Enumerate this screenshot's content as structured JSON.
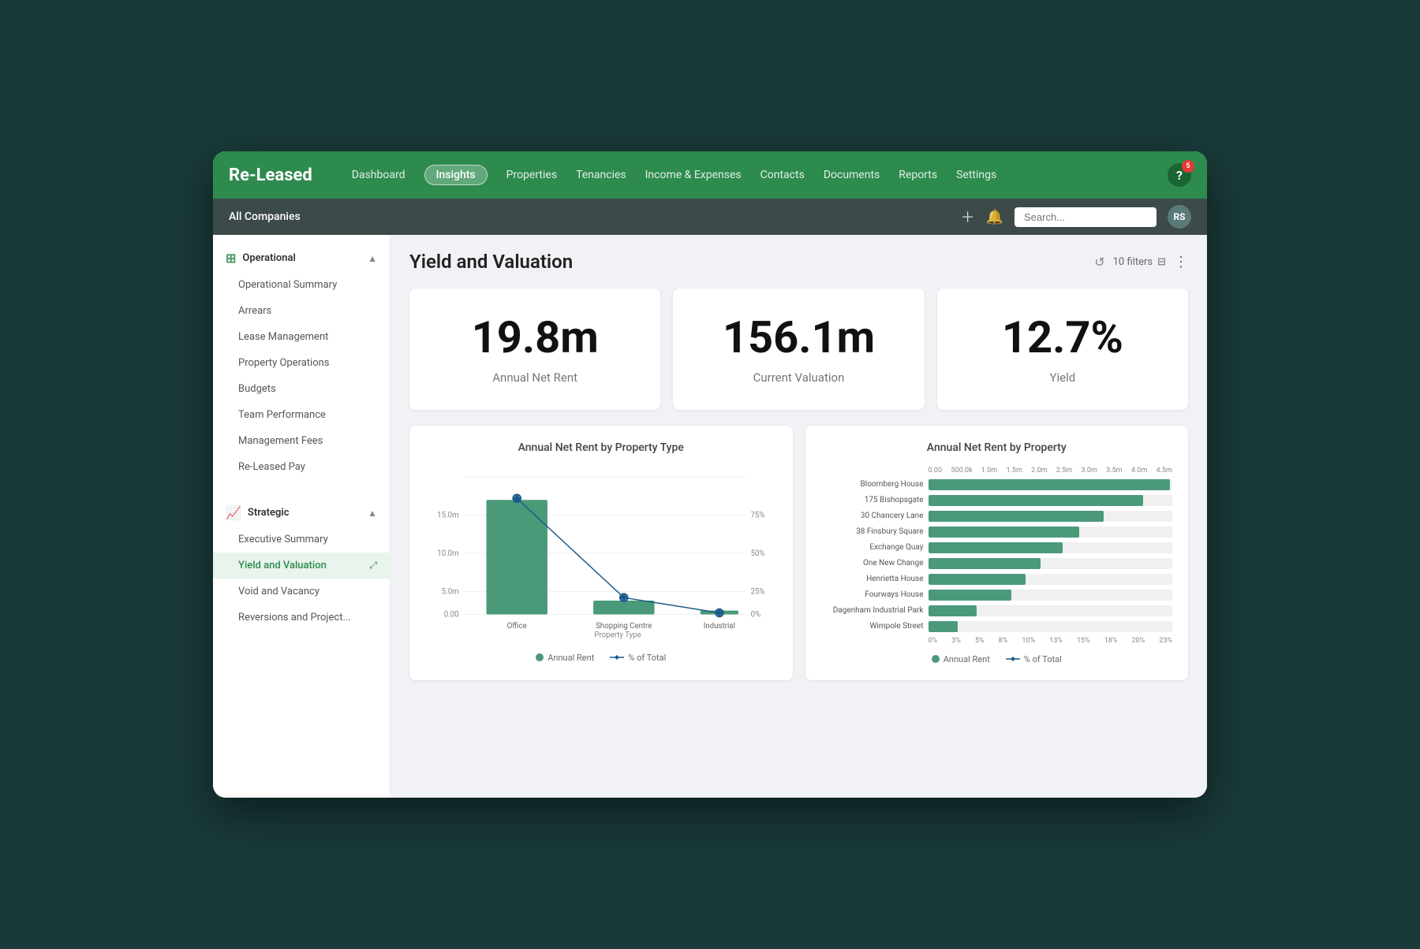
{
  "app": {
    "logo": "Re-Leased",
    "nav_items": [
      {
        "label": "Dashboard",
        "active": false
      },
      {
        "label": "Insights",
        "active": true
      },
      {
        "label": "Properties",
        "active": false
      },
      {
        "label": "Tenancies",
        "active": false
      },
      {
        "label": "Income & Expenses",
        "active": false
      },
      {
        "label": "Contacts",
        "active": false
      },
      {
        "label": "Documents",
        "active": false
      },
      {
        "label": "Reports",
        "active": false
      },
      {
        "label": "Settings",
        "active": false
      }
    ],
    "help_label": "?",
    "help_badge": "5"
  },
  "subnav": {
    "company": "All Companies",
    "search_placeholder": "Search...",
    "avatar": "RS"
  },
  "sidebar": {
    "operational_label": "Operational",
    "operational_items": [
      {
        "label": "Operational Summary",
        "active": false
      },
      {
        "label": "Arrears",
        "active": false
      },
      {
        "label": "Lease Management",
        "active": false
      },
      {
        "label": "Property Operations",
        "active": false
      },
      {
        "label": "Budgets",
        "active": false
      },
      {
        "label": "Team Performance",
        "active": false
      },
      {
        "label": "Management Fees",
        "active": false
      },
      {
        "label": "Re-Leased Pay",
        "active": false
      }
    ],
    "strategic_label": "Strategic",
    "strategic_items": [
      {
        "label": "Executive Summary",
        "active": false
      },
      {
        "label": "Yield and Valuation",
        "active": true
      },
      {
        "label": "Void and Vacancy",
        "active": false
      },
      {
        "label": "Reversions and Project...",
        "active": false
      }
    ]
  },
  "page": {
    "title": "Yield and Valuation",
    "filters_label": "10 filters",
    "kpi_cards": [
      {
        "value": "19.8m",
        "label": "Annual Net Rent"
      },
      {
        "value": "156.1m",
        "label": "Current Valuation"
      },
      {
        "value": "12.7%",
        "label": "Yield"
      }
    ],
    "chart1": {
      "title": "Annual Net Rent by Property Type",
      "legend_annual": "Annual Rent",
      "legend_pct": "% of Total",
      "bars": [
        {
          "label": "Office",
          "value": 16.2,
          "pct": 75
        },
        {
          "label": "Shopping Centre",
          "value": 1.5,
          "pct": 8
        },
        {
          "label": "Industrial",
          "value": 0.2,
          "pct": 2
        }
      ],
      "y_labels": [
        "0.00",
        "5.0m",
        "10.0m",
        "15.0m"
      ],
      "y2_labels": [
        "0%",
        "25%",
        "50%",
        "75%"
      ],
      "x_labels": [
        "Office",
        "Shopping Centre",
        "Industrial"
      ],
      "x_subtitle": "Property Type"
    },
    "chart2": {
      "title": "Annual Net Rent by Property",
      "legend_annual": "Annual Rent",
      "legend_pct": "% of Total",
      "properties": [
        {
          "label": "Bloomberg House",
          "pct": 99
        },
        {
          "label": "175 Bishopsgate",
          "pct": 88
        },
        {
          "label": "30 Chancery Lane",
          "pct": 72
        },
        {
          "label": "38 Finsbury Square",
          "pct": 62
        },
        {
          "label": "Exchange Quay",
          "pct": 55
        },
        {
          "label": "One New Change",
          "pct": 46
        },
        {
          "label": "Henrietta House",
          "pct": 40
        },
        {
          "label": "Fourways House",
          "pct": 34
        },
        {
          "label": "Dagenham Industrial Park",
          "pct": 20
        },
        {
          "label": "Wimpole Street",
          "pct": 12
        }
      ],
      "x_axis_labels": [
        "0%",
        "3%",
        "5%",
        "8%",
        "10%",
        "13%",
        "15%",
        "18%",
        "20%",
        "23%"
      ]
    }
  }
}
